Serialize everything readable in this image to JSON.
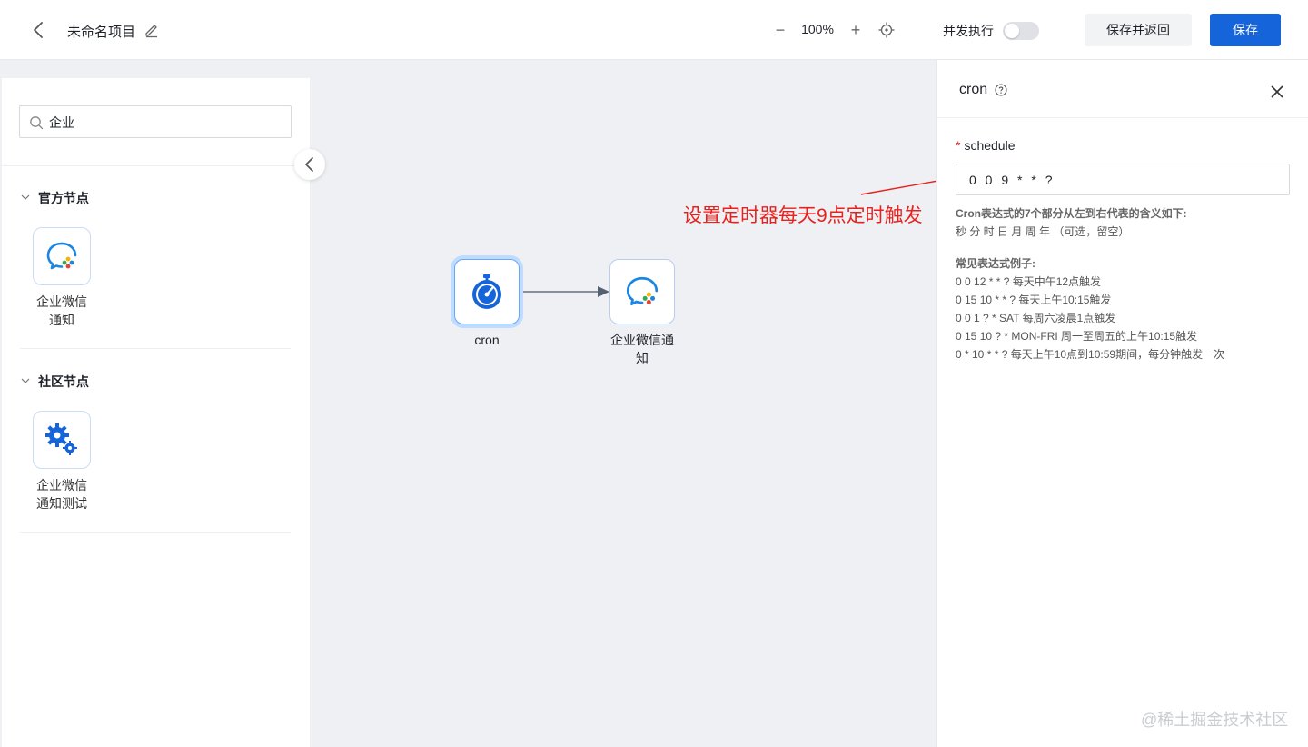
{
  "header": {
    "project_title": "未命名项目",
    "zoom_out_label": "−",
    "zoom_value": "100%",
    "zoom_in_label": "+",
    "concurrent_label": "并发执行",
    "concurrent_on": false,
    "save_return_label": "保存并返回",
    "save_label": "保存"
  },
  "sidebar": {
    "search_value": "企业",
    "sections": [
      {
        "title": "官方节点",
        "nodes": [
          {
            "label_line1": "企业微信",
            "label_line2": "通知",
            "icon": "wecom-chat-icon"
          }
        ]
      },
      {
        "title": "社区节点",
        "nodes": [
          {
            "label_line1": "企业微信",
            "label_line2": "通知测试",
            "icon": "gear-icon"
          }
        ]
      }
    ]
  },
  "canvas": {
    "nodes": [
      {
        "label": "cron",
        "icon": "stopwatch-icon",
        "selected": true
      },
      {
        "label_line1": "企业微信通",
        "label_line2": "知",
        "icon": "wecom-chat-icon",
        "selected": false
      }
    ],
    "annotation": "设置定时器每天9点定时触发"
  },
  "panel": {
    "title": "cron",
    "field_label": "schedule",
    "field_value": "0 0 9 * * ?",
    "help_heading": "Cron表达式的7个部分从左到右代表的含义如下:",
    "help_fields": "秒 分 时 日 月 周 年 （可选，留空）",
    "examples_heading": "常见表达式例子:",
    "examples": [
      "0 0 12 * * ? 每天中午12点触发",
      "0 15 10 * * ? 每天上午10:15触发",
      "0 0 1 ? * SAT 每周六凌晨1点触发",
      "0 15 10 ? * MON-FRI 周一至周五的上午10:15触发",
      "0 * 10 * * ? 每天上午10点到10:59期间，每分钟触发一次"
    ]
  },
  "watermark": "@稀土掘金技术社区",
  "colors": {
    "primary": "#1664d9",
    "annotation": "#e8211d",
    "canvas_bg": "#eef0f3"
  }
}
